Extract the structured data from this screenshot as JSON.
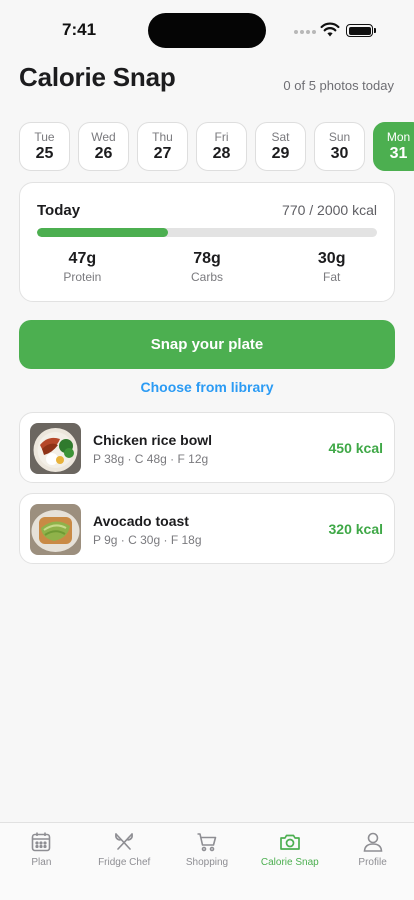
{
  "status_bar": {
    "time": "7:41"
  },
  "header": {
    "title": "Calorie Snap",
    "photo_count": "0 of 5 photos today"
  },
  "dates": [
    {
      "dow": "Tue",
      "day": "25"
    },
    {
      "dow": "Wed",
      "day": "26"
    },
    {
      "dow": "Thu",
      "day": "27"
    },
    {
      "dow": "Fri",
      "day": "28"
    },
    {
      "dow": "Sat",
      "day": "29"
    },
    {
      "dow": "Sun",
      "day": "30"
    },
    {
      "dow": "Mon",
      "day": "31"
    }
  ],
  "today": {
    "label": "Today",
    "summary": "770 / 2000 kcal",
    "progress_fraction": 0.385,
    "accent_color": "#4caf50",
    "macros": [
      {
        "value": "47g",
        "label": "Protein"
      },
      {
        "value": "78g",
        "label": "Carbs"
      },
      {
        "value": "30g",
        "label": "Fat"
      }
    ]
  },
  "actions": {
    "snap_label": "Snap your plate",
    "library_label": "Choose from library"
  },
  "meals": [
    {
      "name": "Chicken rice bowl",
      "macros": "P 38g · C 48g · F 12g",
      "kcal": "450 kcal",
      "photo": "chicken-rice-bowl-photo"
    },
    {
      "name": "Avocado toast",
      "macros": "P 9g · C 30g · F 18g",
      "kcal": "320 kcal",
      "photo": "avocado-toast-photo"
    }
  ],
  "tabs": [
    {
      "label": "Plan",
      "icon": "calendar-icon"
    },
    {
      "label": "Fridge Chef",
      "icon": "utensils-icon"
    },
    {
      "label": "Shopping",
      "icon": "cart-icon"
    },
    {
      "label": "Calorie Snap",
      "icon": "camera-icon",
      "active": true
    },
    {
      "label": "Profile",
      "icon": "person-icon"
    }
  ]
}
